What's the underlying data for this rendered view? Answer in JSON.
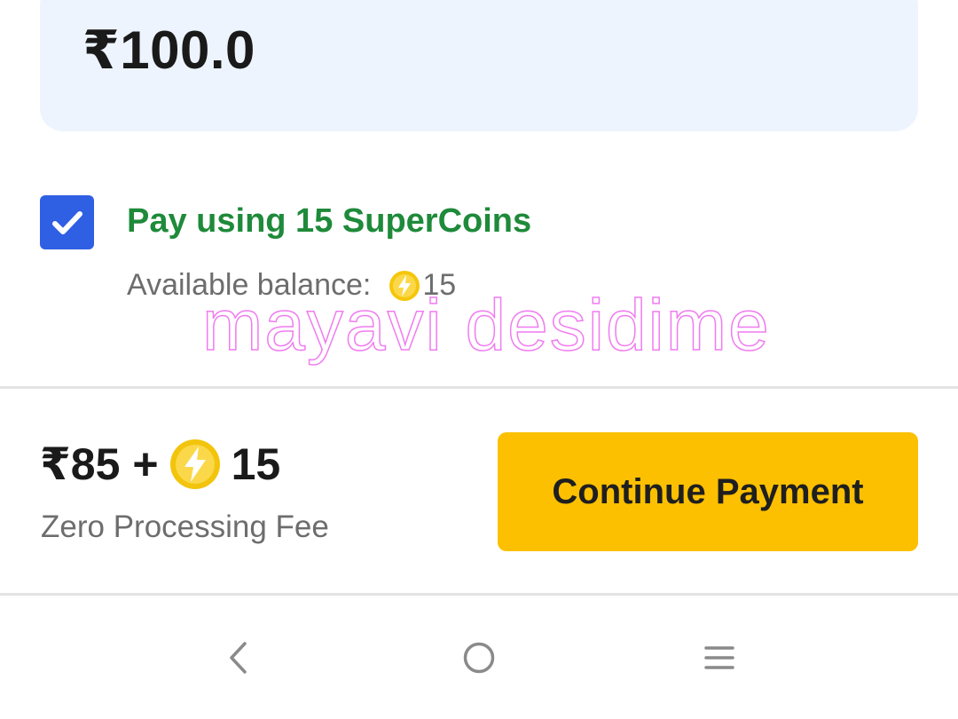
{
  "amount_card": {
    "amount": "₹100.0"
  },
  "supercoins": {
    "checked": true,
    "label": "Pay using 15 SuperCoins",
    "balance_label": "Available balance:",
    "balance_value": "15"
  },
  "watermark": {
    "text": "mayavi desidime"
  },
  "footer": {
    "total_cash": "₹85",
    "plus": "+",
    "total_coins": "15",
    "fee_note": "Zero Processing Fee",
    "continue_label": "Continue Payment"
  },
  "nav": {
    "icons": [
      "back-icon",
      "home-icon",
      "menu-icon"
    ]
  },
  "colors": {
    "card_bg": "#eef4fd",
    "checkbox": "#2f5fe3",
    "coins_label": "#1e8a3a",
    "button": "#fcc000",
    "coin": "#f5c60a"
  }
}
